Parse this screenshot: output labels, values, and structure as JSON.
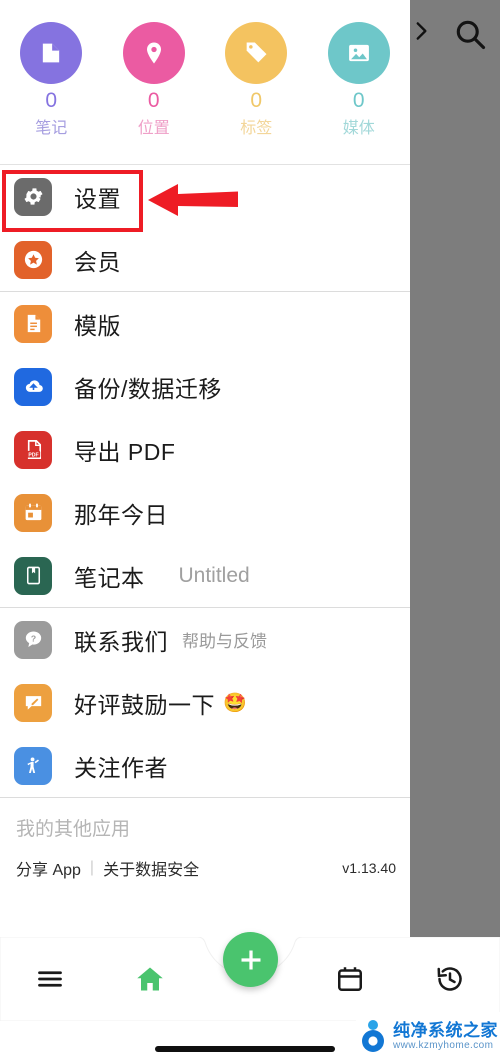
{
  "background": {
    "chevron_icon": "chevron-right-icon",
    "search_icon": "search-icon"
  },
  "drawer": {
    "stats": [
      {
        "icon": "note-page-icon",
        "count": "0",
        "label": "笔记",
        "color": "#8573e0"
      },
      {
        "icon": "location-pin-icon",
        "count": "0",
        "label": "位置",
        "color": "#eb5ba2"
      },
      {
        "icon": "tag-icon",
        "count": "0",
        "label": "标签",
        "color": "#f4c360"
      },
      {
        "icon": "image-icon",
        "count": "0",
        "label": "媒体",
        "color": "#6ec7c9"
      }
    ],
    "sections": [
      {
        "rows": [
          {
            "icon": "gear-icon",
            "label": "设置",
            "color": "#6b6b6b",
            "highlighted": true
          },
          {
            "icon": "star-badge-icon",
            "label": "会员",
            "color": "#e2622a"
          }
        ]
      },
      {
        "rows": [
          {
            "icon": "document-icon",
            "label": "模版",
            "color": "#ee8e3a"
          },
          {
            "icon": "cloud-upload-icon",
            "label": "备份/数据迁移",
            "color": "#2069e0"
          },
          {
            "icon": "pdf-icon",
            "label": "导出 PDF",
            "color": "#d7312c"
          },
          {
            "icon": "calendar-icon",
            "label": "那年今日",
            "color": "#e89138"
          },
          {
            "icon": "notebook-icon",
            "label": "笔记本",
            "color": "#2a6652",
            "value": "Untitled"
          }
        ]
      },
      {
        "rows": [
          {
            "icon": "help-bubble-icon",
            "label": "联系我们",
            "color": "#9b9b9b",
            "sub": "帮助与反馈"
          },
          {
            "icon": "review-pencil-icon",
            "label": "好评鼓励一下",
            "color": "#eda03f",
            "emoji": "🤩"
          },
          {
            "icon": "person-wave-icon",
            "label": "关注作者",
            "color": "#4a90e2"
          }
        ]
      }
    ],
    "footer": {
      "other_apps_label": "我的其他应用",
      "share_app": "分享 App",
      "separator": "|",
      "data_safety": "关于数据安全",
      "version": "v1.13.40"
    }
  },
  "annotation": {
    "highlight_color": "#ee1c25",
    "arrow_color": "#ee1c25",
    "target": "设置"
  },
  "bottom_nav": {
    "items": [
      {
        "icon": "hamburger-menu-icon",
        "active": false
      },
      {
        "icon": "home-icon",
        "active": true
      },
      {
        "icon": "calendar-outline-icon",
        "active": false
      },
      {
        "icon": "history-icon",
        "active": false
      }
    ],
    "fab": {
      "icon": "plus-icon",
      "color": "#4ac46e"
    }
  },
  "watermark": {
    "title": "纯净系统之家",
    "url": "www.kzmyhome.com"
  }
}
